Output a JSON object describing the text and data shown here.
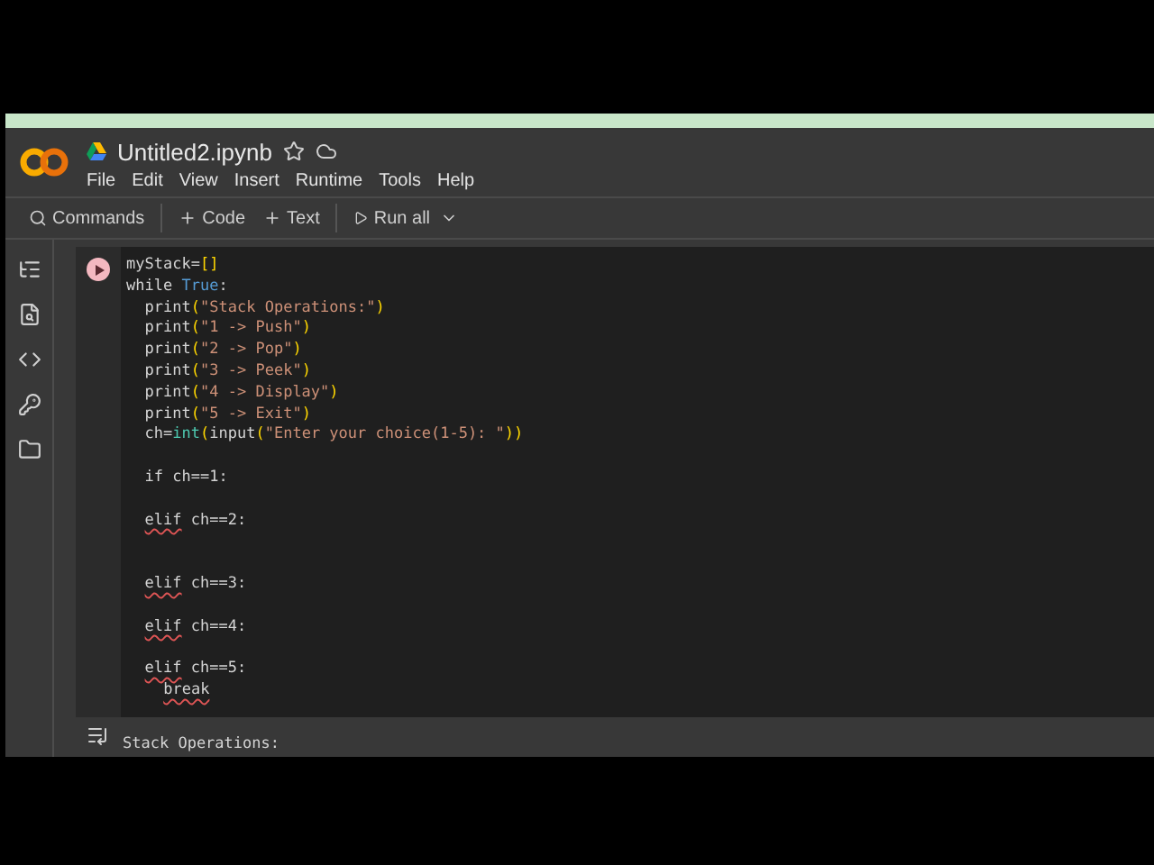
{
  "notebook": {
    "title": "Untitled2.ipynb"
  },
  "menu": [
    "File",
    "Edit",
    "View",
    "Insert",
    "Runtime",
    "Tools",
    "Help"
  ],
  "toolbar": [
    {
      "kind": "search",
      "label": "Commands"
    },
    {
      "kind": "add",
      "label": "Code"
    },
    {
      "kind": "add",
      "label": "Text"
    },
    {
      "kind": "run",
      "label": "Run all"
    }
  ],
  "sidebar": [
    {
      "kind": "toc"
    },
    {
      "kind": "find"
    },
    {
      "kind": "code"
    },
    {
      "kind": "key"
    },
    {
      "kind": "folder"
    }
  ],
  "cell": {
    "lines": [
      {
        "kind": "code",
        "tokens": [
          {
            "kind": "plain",
            "text": "myStack="
          },
          {
            "kind": "bracket",
            "text": "[]"
          }
        ]
      },
      {
        "kind": "code",
        "tokens": [
          {
            "kind": "plain",
            "text": "while "
          },
          {
            "kind": "keyword",
            "text": "True"
          },
          {
            "kind": "plain",
            "text": ":"
          }
        ],
        "children": [
          {
            "kind": "code",
            "tokens": [
              {
                "kind": "plain",
                "text": "print"
              },
              {
                "kind": "bracket",
                "text": "("
              },
              {
                "kind": "string",
                "text": "\"Stack Operations:\""
              },
              {
                "kind": "bracket",
                "text": ")"
              }
            ]
          },
          {
            "kind": "code",
            "tokens": [
              {
                "kind": "plain",
                "text": "print"
              },
              {
                "kind": "bracket",
                "text": "("
              },
              {
                "kind": "string",
                "text": "\"1 -> Push\""
              },
              {
                "kind": "bracket",
                "text": ")"
              }
            ]
          },
          {
            "kind": "code",
            "tokens": [
              {
                "kind": "plain",
                "text": "print"
              },
              {
                "kind": "bracket",
                "text": "("
              },
              {
                "kind": "string",
                "text": "\"2 -> Pop\""
              },
              {
                "kind": "bracket",
                "text": ")"
              }
            ]
          },
          {
            "kind": "code",
            "tokens": [
              {
                "kind": "plain",
                "text": "print"
              },
              {
                "kind": "bracket",
                "text": "("
              },
              {
                "kind": "string",
                "text": "\"3 -> Peek\""
              },
              {
                "kind": "bracket",
                "text": ")"
              }
            ]
          },
          {
            "kind": "code",
            "tokens": [
              {
                "kind": "plain",
                "text": "print"
              },
              {
                "kind": "bracket",
                "text": "("
              },
              {
                "kind": "string",
                "text": "\"4 -> Display\""
              },
              {
                "kind": "bracket",
                "text": ")"
              }
            ]
          },
          {
            "kind": "code",
            "tokens": [
              {
                "kind": "plain",
                "text": "print"
              },
              {
                "kind": "bracket",
                "text": "("
              },
              {
                "kind": "string",
                "text": "\"5 -> Exit\""
              },
              {
                "kind": "bracket",
                "text": ")"
              }
            ]
          },
          {
            "kind": "code",
            "tokens": [
              {
                "kind": "plain",
                "text": "ch="
              },
              {
                "kind": "builtin",
                "text": "int"
              },
              {
                "kind": "bracket",
                "text": "("
              },
              {
                "kind": "plain",
                "text": "input"
              },
              {
                "kind": "bracket",
                "text": "("
              },
              {
                "kind": "string",
                "text": "\"Enter your choice(1-5): \""
              },
              {
                "kind": "bracket",
                "text": "))"
              }
            ]
          },
          {
            "kind": "blank"
          },
          {
            "kind": "code",
            "tokens": [
              {
                "kind": "plain",
                "text": "if ch==1:"
              }
            ]
          },
          {
            "kind": "blank"
          },
          {
            "kind": "code",
            "tokens": [
              {
                "kind": "error",
                "text": "elif"
              },
              {
                "kind": "plain",
                "text": " ch==2:"
              }
            ]
          },
          {
            "kind": "blank"
          },
          {
            "kind": "blank"
          },
          {
            "kind": "code",
            "tokens": [
              {
                "kind": "error",
                "text": "elif"
              },
              {
                "kind": "plain",
                "text": " ch==3:"
              }
            ]
          },
          {
            "kind": "blank"
          },
          {
            "kind": "code",
            "tokens": [
              {
                "kind": "error",
                "text": "elif"
              },
              {
                "kind": "plain",
                "text": " ch==4:"
              }
            ]
          },
          {
            "kind": "blank"
          },
          {
            "kind": "code",
            "tokens": [
              {
                "kind": "error",
                "text": "elif"
              },
              {
                "kind": "plain",
                "text": " ch==5:"
              }
            ],
            "children": [
              {
                "kind": "code",
                "tokens": [
                  {
                    "kind": "error",
                    "text": "break"
                  }
                ]
              }
            ]
          }
        ]
      }
    ]
  },
  "output": [
    "Stack Operations:"
  ]
}
